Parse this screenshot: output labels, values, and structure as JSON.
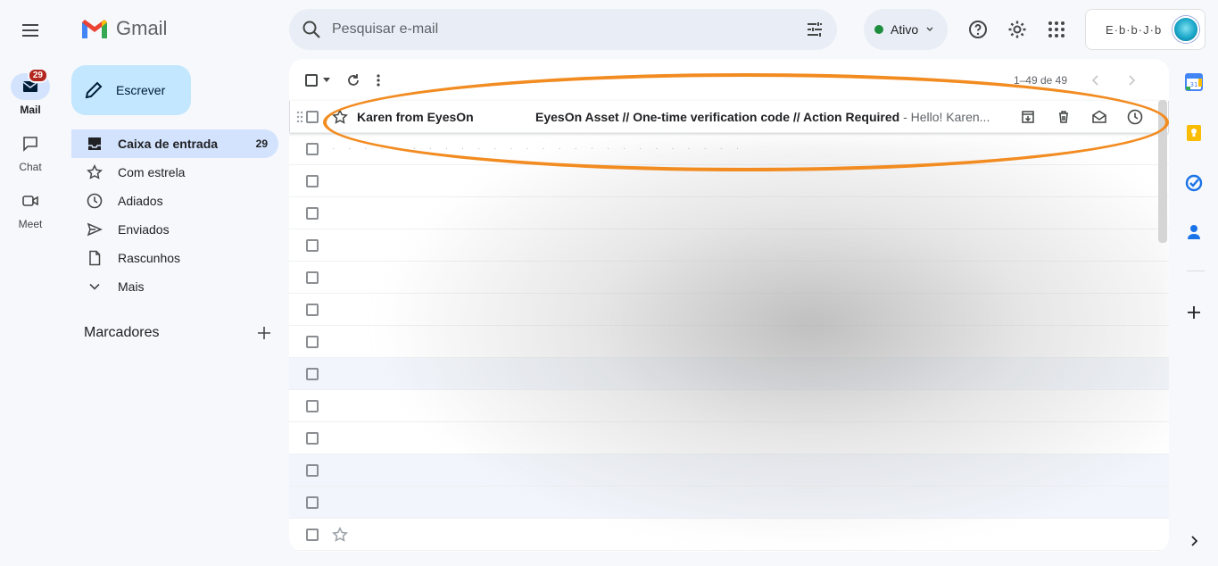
{
  "app": {
    "name": "Gmail",
    "brand_colors": {
      "red": "#ea4335",
      "blue": "#4285f4",
      "green": "#34a853",
      "yellow": "#fbbc04"
    }
  },
  "rail": {
    "mail_label": "Mail",
    "mail_badge": "29",
    "chat_label": "Chat",
    "meet_label": "Meet"
  },
  "search": {
    "placeholder": "Pesquisar e-mail"
  },
  "status": {
    "label": "Ativo"
  },
  "account": {
    "name": "E·b·b·J·b"
  },
  "compose": {
    "label": "Escrever"
  },
  "nav": {
    "items": [
      {
        "label": "Caixa de entrada",
        "count": "29",
        "icon": "inbox-icon"
      },
      {
        "label": "Com estrela",
        "icon": "star-icon"
      },
      {
        "label": "Adiados",
        "icon": "clock-icon"
      },
      {
        "label": "Enviados",
        "icon": "send-icon"
      },
      {
        "label": "Rascunhos",
        "icon": "draft-icon"
      },
      {
        "label": "Mais",
        "icon": "chevron-down-icon"
      }
    ],
    "labels_heading": "Marcadores"
  },
  "toolbar": {
    "pager": "1–49 de 49"
  },
  "emails": [
    {
      "sender": "Karen from EyesOn",
      "subject": "EyesOn Asset // One-time verification code // Action Required",
      "snippet": " - Hello! Karen..."
    }
  ],
  "highlight_color": "#f28b20"
}
